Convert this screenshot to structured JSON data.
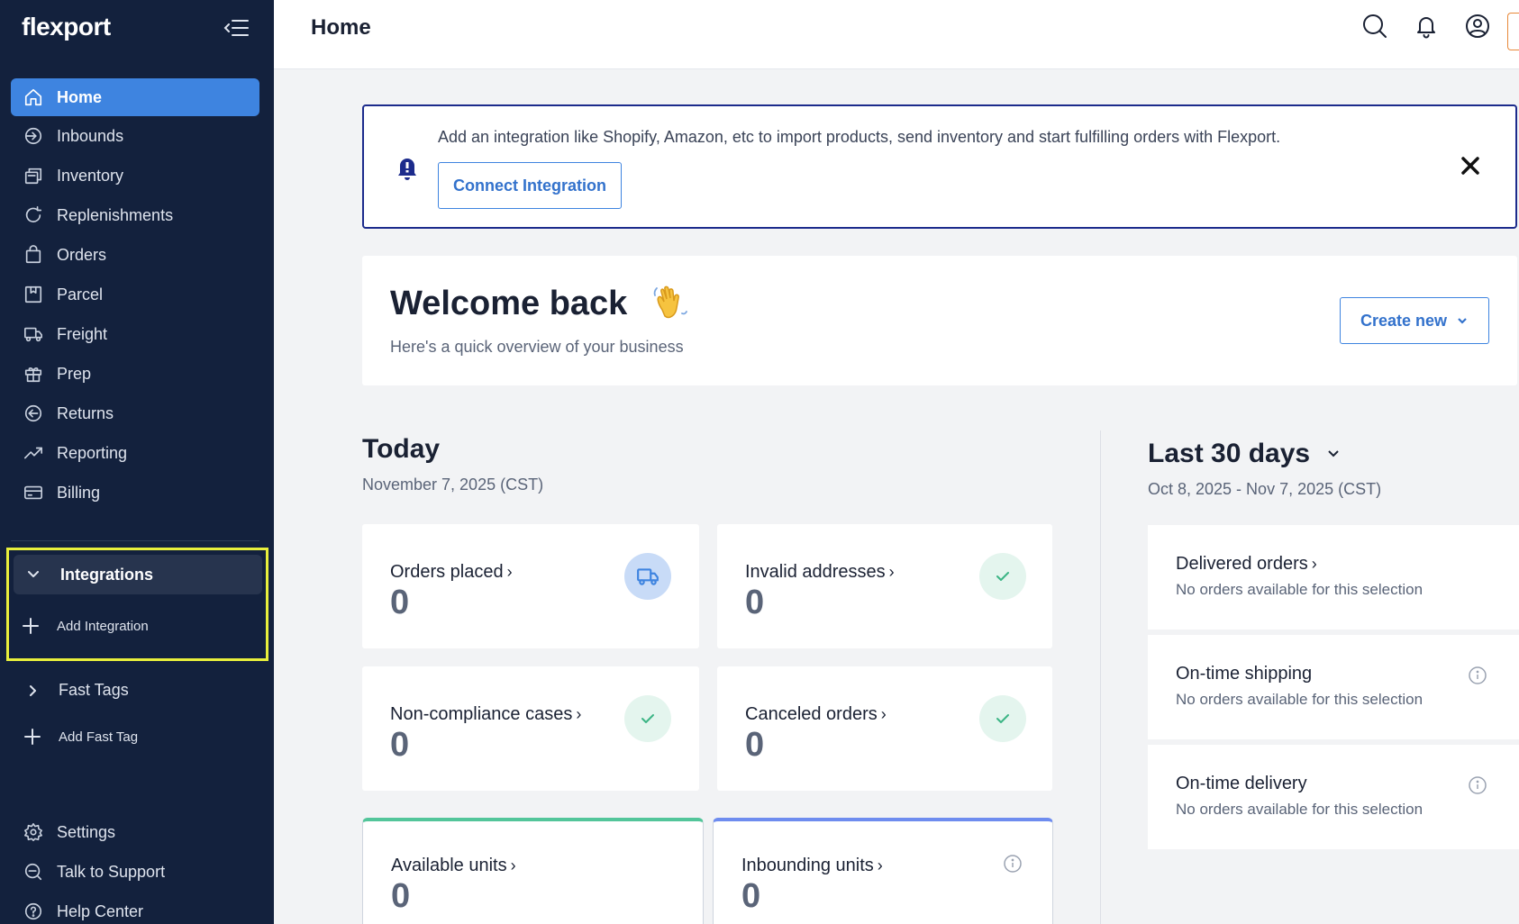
{
  "app": {
    "logo": "flexport"
  },
  "sidebar": {
    "items": [
      {
        "label": "Home",
        "icon": "home-icon",
        "active": true
      },
      {
        "label": "Inbounds",
        "icon": "inbound-icon"
      },
      {
        "label": "Inventory",
        "icon": "inventory-icon"
      },
      {
        "label": "Replenishments",
        "icon": "replenish-icon"
      },
      {
        "label": "Orders",
        "icon": "shopping-bag-icon"
      },
      {
        "label": "Parcel",
        "icon": "parcel-icon"
      },
      {
        "label": "Freight",
        "icon": "truck-icon"
      },
      {
        "label": "Prep",
        "icon": "gift-icon"
      },
      {
        "label": "Returns",
        "icon": "return-icon"
      },
      {
        "label": "Reporting",
        "icon": "trend-icon"
      },
      {
        "label": "Billing",
        "icon": "credit-card-icon"
      }
    ],
    "integrations": {
      "label": "Integrations",
      "add_label": "Add Integration"
    },
    "fast_tags": {
      "label": "Fast Tags",
      "add_label": "Add Fast Tag"
    },
    "bottom_items": [
      {
        "label": "Settings",
        "icon": "gear-icon"
      },
      {
        "label": "Talk to Support",
        "icon": "chat-icon"
      },
      {
        "label": "Help Center",
        "icon": "help-icon"
      }
    ]
  },
  "header": {
    "title": "Home"
  },
  "banner": {
    "text": "Add an integration like Shopify, Amazon, etc to import products, send inventory and start fulfilling orders with Flexport.",
    "button": "Connect Integration"
  },
  "welcome": {
    "title": "Welcome back",
    "subtitle": "Here's a quick overview of your business",
    "create_button": "Create new"
  },
  "today": {
    "title": "Today",
    "date": "November 7, 2025 (CST)",
    "cards": [
      {
        "label": "Orders placed",
        "value": "0",
        "icon": "truck-icon"
      },
      {
        "label": "Invalid addresses",
        "value": "0",
        "icon": "check-icon"
      },
      {
        "label": "Non-compliance cases",
        "value": "0",
        "icon": "check-icon"
      },
      {
        "label": "Canceled orders",
        "value": "0",
        "icon": "check-icon"
      }
    ],
    "units": [
      {
        "label": "Available units",
        "value": "0"
      },
      {
        "label": "Inbounding units",
        "value": "0"
      }
    ]
  },
  "last30": {
    "title": "Last 30 days",
    "range": "Oct 8, 2025 - Nov 7, 2025 (CST)",
    "cards": [
      {
        "label": "Delivered orders",
        "sub": "No orders available for this selection"
      },
      {
        "label": "On-time shipping",
        "sub": "No orders available for this selection"
      },
      {
        "label": "On-time delivery",
        "sub": "No orders available for this selection"
      }
    ]
  },
  "colors": {
    "sidebar": "#13213d",
    "accent": "#3e84e0",
    "highlight": "#e8ef3c",
    "banner_border": "#1c2b8c"
  }
}
